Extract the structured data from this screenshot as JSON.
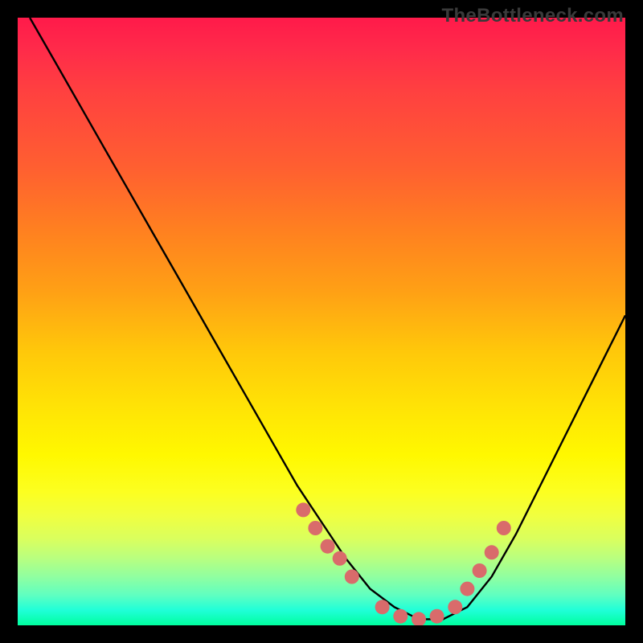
{
  "watermark": "TheBottleneck.com",
  "chart_data": {
    "type": "line",
    "title": "",
    "xlabel": "",
    "ylabel": "",
    "xlim": [
      0,
      100
    ],
    "ylim": [
      0,
      100
    ],
    "series": [
      {
        "name": "bottleneck-curve",
        "x": [
          2,
          6,
          10,
          14,
          18,
          22,
          26,
          30,
          34,
          38,
          42,
          46,
          50,
          54,
          58,
          62,
          66,
          70,
          74,
          78,
          82,
          86,
          90,
          94,
          98,
          100
        ],
        "y": [
          100,
          93,
          86,
          79,
          72,
          65,
          58,
          51,
          44,
          37,
          30,
          23,
          17,
          11,
          6,
          3,
          1,
          1,
          3,
          8,
          15,
          23,
          31,
          39,
          47,
          51
        ]
      }
    ],
    "markers": {
      "name": "highlight-dots",
      "color": "#d96b6b",
      "x": [
        47,
        49,
        51,
        53,
        55,
        60,
        63,
        66,
        69,
        72,
        74,
        76,
        78,
        80
      ],
      "y": [
        19,
        16,
        13,
        11,
        8,
        3,
        1.5,
        1,
        1.5,
        3,
        6,
        9,
        12,
        16
      ]
    },
    "background": "rainbow-gradient-vertical"
  }
}
